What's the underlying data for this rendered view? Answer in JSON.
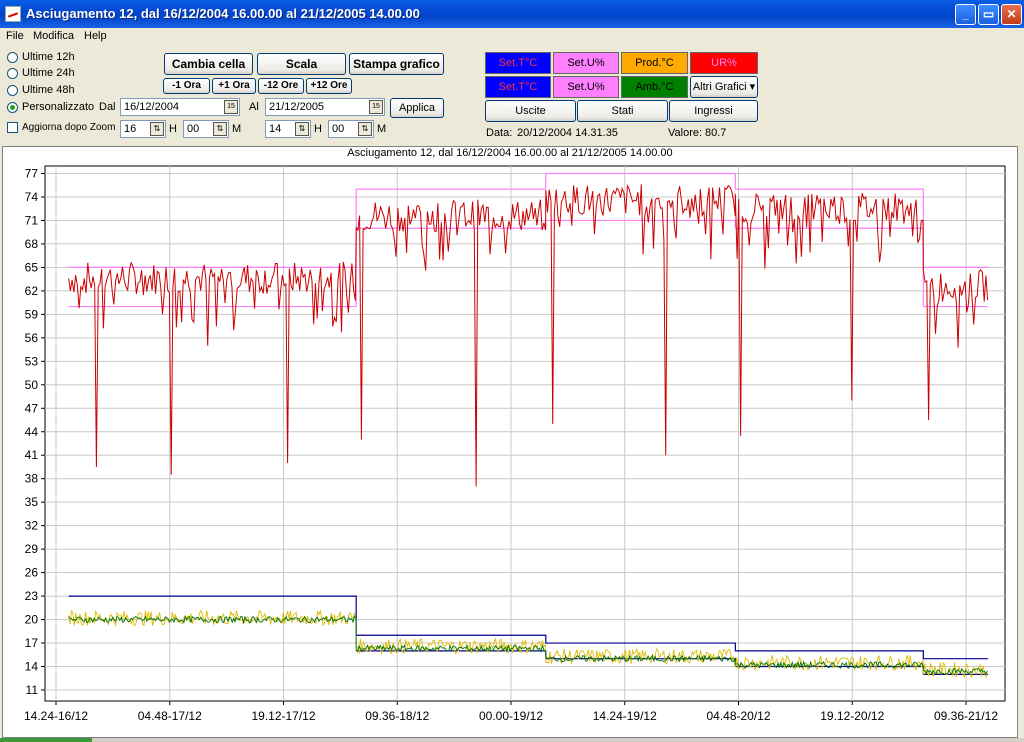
{
  "window": {
    "title": "Asciugamento 12, dal 16/12/2004 16.00.00 al 21/12/2005 14.00.00",
    "minimize": "_",
    "maximize": "▭",
    "close": "✕"
  },
  "menu": [
    "File",
    "Modifica",
    "Help"
  ],
  "range_options": [
    {
      "label": "Ultime 12h",
      "selected": false
    },
    {
      "label": "Ultime 24h",
      "selected": false
    },
    {
      "label": "Ultime 48h",
      "selected": false
    },
    {
      "label": "Personalizzato",
      "selected": true
    }
  ],
  "update_after_zoom": "Aggiorna dopo Zoom",
  "buttons": {
    "cambia_cella": "Cambia cella",
    "scala": "Scala",
    "stampa": "Stampa grafico",
    "minus1": "-1 Ora",
    "plus1": "+1 Ora",
    "minus12": "-12 Ore",
    "plus12": "+12 Ore",
    "applica": "Applica"
  },
  "from": {
    "label": "Dal",
    "date": "16/12/2004",
    "hour": "16",
    "minute": "00",
    "cal": "15"
  },
  "to": {
    "label": "Al",
    "date": "21/12/2005",
    "hour": "14",
    "minute": "00",
    "cal": "15"
  },
  "hm": {
    "h": "H",
    "m": "M"
  },
  "legend_buttons": [
    {
      "label": "Set.T°C",
      "bg": "#0000ff",
      "fg": "#ff3030"
    },
    {
      "label": "Set.U%",
      "bg": "#ff80ff",
      "fg": "#000000"
    },
    {
      "label": "Prod.°C",
      "bg": "#ffaa00",
      "fg": "#000000"
    },
    {
      "label": "UR%",
      "bg": "#ff0000",
      "fg": "#ff80ff"
    },
    {
      "label": "Set.T°C",
      "bg": "#0000ff",
      "fg": "#ff3030"
    },
    {
      "label": "Set.U%",
      "bg": "#ff80ff",
      "fg": "#000000"
    },
    {
      "label": "Amb.°C",
      "bg": "#008000",
      "fg": "#000000"
    }
  ],
  "altri_grafici": "Altri Grafici",
  "nav_buttons": [
    "Uscite",
    "Stati",
    "Ingressi"
  ],
  "cursor": {
    "date_label": "Data:",
    "date": "20/12/2004 14.31.35",
    "value_label": "Valore:",
    "value": "80.7"
  },
  "chart_data": {
    "type": "line",
    "title": "Asciugamento 12, dal 16/12/2004 16.00.00 al 21/12/2005 14.00.00",
    "ylim": [
      11,
      78
    ],
    "yticks": [
      11,
      14,
      17,
      20,
      23,
      26,
      29,
      32,
      35,
      38,
      41,
      44,
      47,
      50,
      53,
      56,
      59,
      62,
      65,
      68,
      71,
      74,
      77
    ],
    "xlim_hours": [
      0,
      120
    ],
    "xticks": [
      {
        "label": "14.24-16/12",
        "t": 0
      },
      {
        "label": "04.48-17/12",
        "t": 14.4
      },
      {
        "label": "19.12-17/12",
        "t": 28.8
      },
      {
        "label": "09.36-18/12",
        "t": 43.2
      },
      {
        "label": "00.00-19/12",
        "t": 57.6
      },
      {
        "label": "14.24-19/12",
        "t": 72
      },
      {
        "label": "04.48-20/12",
        "t": 86.4
      },
      {
        "label": "19.12-20/12",
        "t": 100.8
      },
      {
        "label": "09.36-21/12",
        "t": 115.2
      }
    ],
    "grid": true,
    "series": [
      {
        "name": "Set.U%",
        "color": "#ff80ff",
        "steps": [
          [
            1.6,
            38.0,
            60,
            65
          ],
          [
            38.0,
            62.0,
            70,
            75
          ],
          [
            62.0,
            86.0,
            71,
            77
          ],
          [
            86.0,
            109.8,
            70,
            75
          ],
          [
            109.8,
            118.0,
            60,
            65
          ]
        ]
      },
      {
        "name": "UR%",
        "color": "#cc0000",
        "steps": [
          [
            1.6,
            38.0,
            63
          ],
          [
            38.0,
            62.0,
            71
          ],
          [
            62.0,
            86.0,
            73
          ],
          [
            86.0,
            109.8,
            72
          ],
          [
            109.8,
            118.0,
            62
          ]
        ],
        "dips": [
          [
            5.2,
            39.5
          ],
          [
            14.6,
            38.5
          ],
          [
            19.2,
            55
          ],
          [
            29.3,
            40
          ],
          [
            38.7,
            43
          ],
          [
            53.1,
            37
          ],
          [
            62.9,
            45
          ],
          [
            77.2,
            41
          ],
          [
            86.7,
            43.5
          ],
          [
            100.8,
            48
          ],
          [
            110.4,
            45.5
          ]
        ]
      },
      {
        "name": "Set.T°C",
        "color": "#000090",
        "steps": [
          [
            1.6,
            38.0,
            23
          ],
          [
            38.0,
            62.0,
            18
          ],
          [
            62.0,
            86.0,
            17
          ],
          [
            86.0,
            109.8,
            16
          ],
          [
            109.8,
            118.0,
            15
          ],
          [
            38.0,
            62.0,
            16
          ],
          [
            62.0,
            86.0,
            15
          ],
          [
            86.0,
            109.8,
            14
          ],
          [
            109.8,
            118.0,
            13
          ]
        ]
      },
      {
        "name": "Prod.°C",
        "color": "#ddbb00",
        "steps": [
          [
            1.6,
            38.0,
            20.2
          ],
          [
            38.0,
            62.0,
            16.6
          ],
          [
            62.0,
            86.0,
            15.3
          ],
          [
            86.0,
            109.8,
            14.5
          ],
          [
            109.8,
            118.0,
            13.6
          ]
        ]
      },
      {
        "name": "Amb.°C",
        "color": "#007000",
        "steps": [
          [
            1.6,
            38.0,
            20.0
          ],
          [
            38.0,
            62.0,
            16.3
          ],
          [
            62.0,
            86.0,
            15.0
          ],
          [
            86.0,
            109.8,
            14.2
          ],
          [
            109.8,
            118.0,
            13.4
          ]
        ]
      }
    ]
  }
}
